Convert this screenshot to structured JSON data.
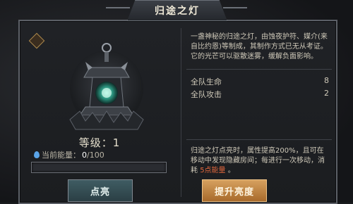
{
  "window": {
    "title": "归途之灯"
  },
  "lamp": {
    "level_label": "等级：1",
    "energy_label": "当前能量：",
    "energy_current": "0",
    "energy_max": "/100",
    "energy_fraction": 0,
    "light_button": "点亮"
  },
  "info": {
    "description": "一盏神秘的归途之灯，由蚀夜护符、媒介(来自比约恩)等制成，其制作方式已无从考证。它的光芒可以驱散迷雾，缓解负面影响。",
    "stats": [
      {
        "label": "全队生命",
        "value": "8"
      },
      {
        "label": "全队攻击",
        "value": "2"
      }
    ],
    "effect_pre": "归途之灯点亮时，属性提高200%，且可在移动中发现隐藏房间；每进行一次移动，消耗 ",
    "effect_cost": "5点能量",
    "effect_post": " 。",
    "boost_button": "提升亮度"
  },
  "colors": {
    "accent": "#e0673d",
    "energy": "#5aa4e8",
    "boost": "#d6a15f"
  }
}
